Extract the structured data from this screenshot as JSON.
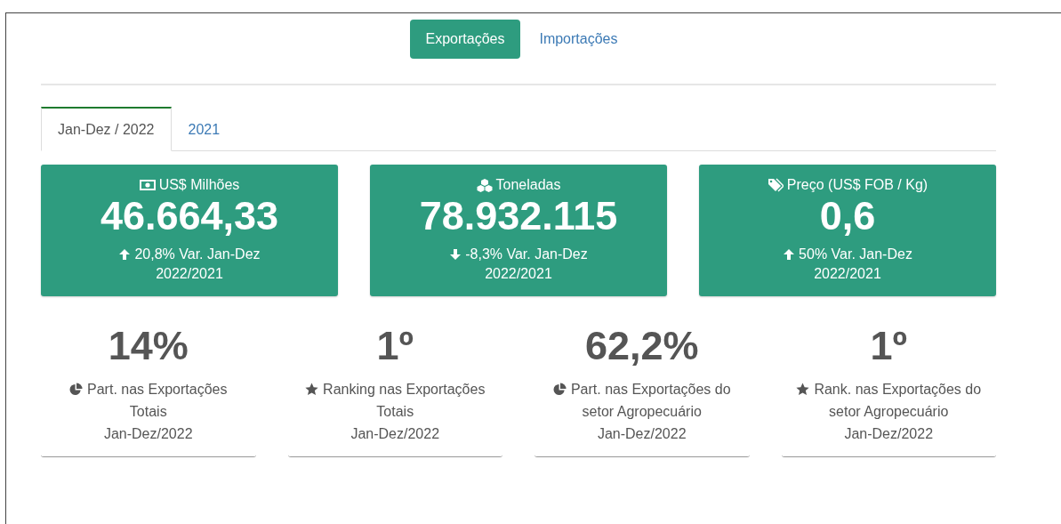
{
  "nav_tabs": [
    {
      "label": "Exportações",
      "selected": true
    },
    {
      "label": "Importações",
      "selected": false
    }
  ],
  "period_tabs": [
    {
      "label": "Jan-Dez / 2022",
      "selected": true
    },
    {
      "label": "2021",
      "selected": false
    }
  ],
  "cards": [
    {
      "kind": "money",
      "title": "US$ Milhões",
      "value": "46.664,33",
      "rising": true,
      "change": "20,8% Var. Jan-Dez",
      "period": "2022/2021"
    },
    {
      "kind": "cubes",
      "title": "Toneladas",
      "value": "78.932.115",
      "rising": false,
      "change": "-8,3% Var. Jan-Dez",
      "period": "2022/2021"
    },
    {
      "kind": "tag",
      "title": "Preço (US$ FOB / Kg)",
      "value": "0,6",
      "rising": true,
      "change": "50% Var. Jan-Dez",
      "period": "2022/2021"
    }
  ],
  "stats": [
    {
      "value": "14%",
      "kind": "pie",
      "label_lines": [
        "Part. nas Exportações",
        "Totais"
      ],
      "period": "Jan-Dez/2022"
    },
    {
      "value": "1º",
      "kind": "star",
      "label_lines": [
        "Ranking nas Exportações",
        "Totais"
      ],
      "period": "Jan-Dez/2022"
    },
    {
      "value": "62,2%",
      "kind": "pie",
      "label_lines": [
        "Part. nas Exportações do",
        "setor Agropecuário"
      ],
      "period": "Jan-Dez/2022"
    },
    {
      "value": "1º",
      "kind": "star",
      "label_lines": [
        "Rank. nas Exportações do",
        "setor Agropecuário"
      ],
      "period": "Jan-Dez/2022"
    }
  ]
}
